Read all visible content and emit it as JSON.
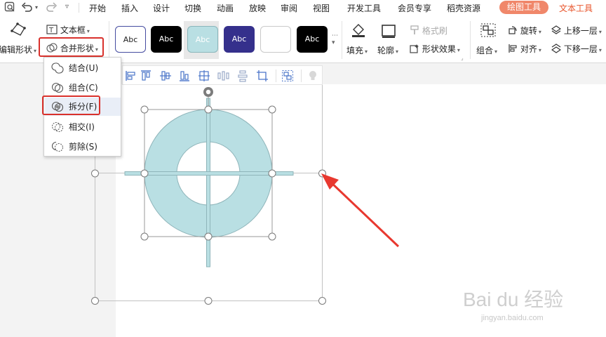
{
  "menubar": {
    "tabs": [
      "开始",
      "插入",
      "设计",
      "切换",
      "动画",
      "放映",
      "审阅",
      "视图",
      "开发工具",
      "会员专享",
      "稻壳资源"
    ],
    "active_tool_tab": "绘图工具",
    "text_tool_tab": "文本工具"
  },
  "ribbon": {
    "edit_shape": "编辑形状",
    "text_box": "文本框",
    "merge_shape": "合并形状",
    "style_samples": [
      "Abc",
      "Abc",
      "Abc",
      "Abc",
      "",
      "Abc"
    ],
    "fill": "填充",
    "outline": "轮廓",
    "format_painter": "格式刷",
    "shape_effects": "形状效果",
    "group": "组合",
    "rotate": "旋转",
    "align": "对齐",
    "bring_forward": "上移一层",
    "send_backward": "下移一层"
  },
  "dropdown": {
    "items": [
      "结合(U)",
      "组合(C)",
      "拆分(F)",
      "相交(I)",
      "剪除(S)"
    ]
  },
  "watermark": {
    "main": "Bai du 经验",
    "sub": "jingyan.baidu.com"
  },
  "colors": {
    "accent": "#f0876a",
    "highlight_border": "#d9312c",
    "shape_fill": "#b9dfe3",
    "arrow": "#e8382f"
  }
}
